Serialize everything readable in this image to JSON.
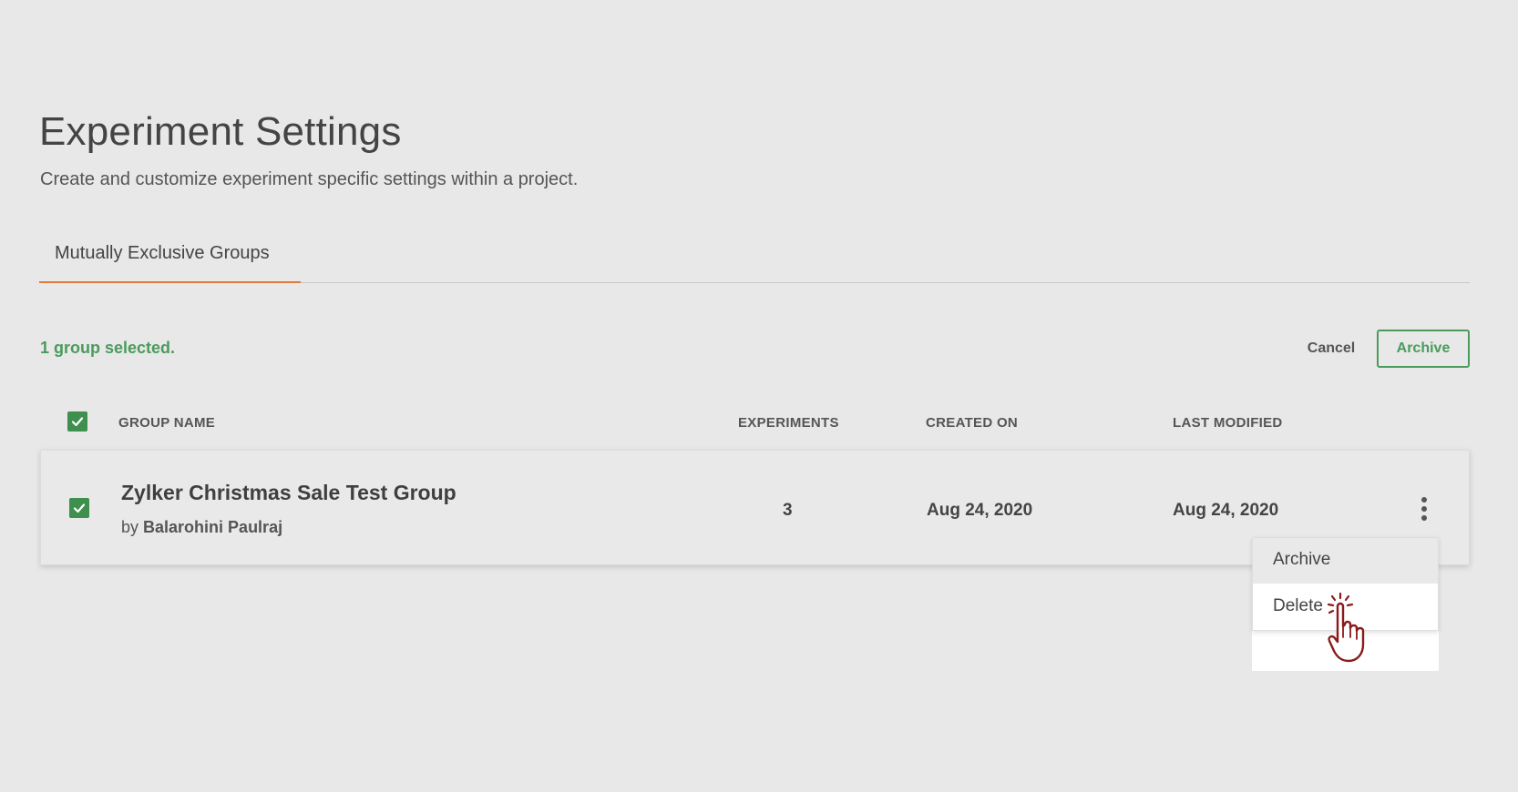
{
  "page": {
    "title": "Experiment Settings",
    "subtitle": "Create and customize experiment specific settings within a project."
  },
  "tabs": [
    {
      "label": "Mutually Exclusive Groups"
    }
  ],
  "selection": {
    "count_text": "1 group selected.",
    "cancel_label": "Cancel",
    "archive_label": "Archive"
  },
  "table": {
    "columns": [
      "GROUP NAME",
      "EXPERIMENTS",
      "CREATED ON",
      "LAST MODIFIED"
    ],
    "rows": [
      {
        "name": "Zylker Christmas Sale Test Group",
        "by": "by",
        "owner": "Balarohini Paulraj",
        "experiments": "3",
        "created_on": "Aug 24, 2020",
        "last_modified": "Aug 24, 2020",
        "selected": true
      }
    ]
  },
  "row_menu": {
    "items": [
      {
        "label": "Archive"
      },
      {
        "label": "Delete"
      }
    ]
  },
  "colors": {
    "accent_green": "#4a9b5c",
    "checkbox_green": "#3f8f4f",
    "tab_underline": "#e07a3f",
    "cursor": "#8b1a1a"
  },
  "icons": [
    "check-icon",
    "kebab-menu-icon",
    "hand-pointer-icon"
  ]
}
